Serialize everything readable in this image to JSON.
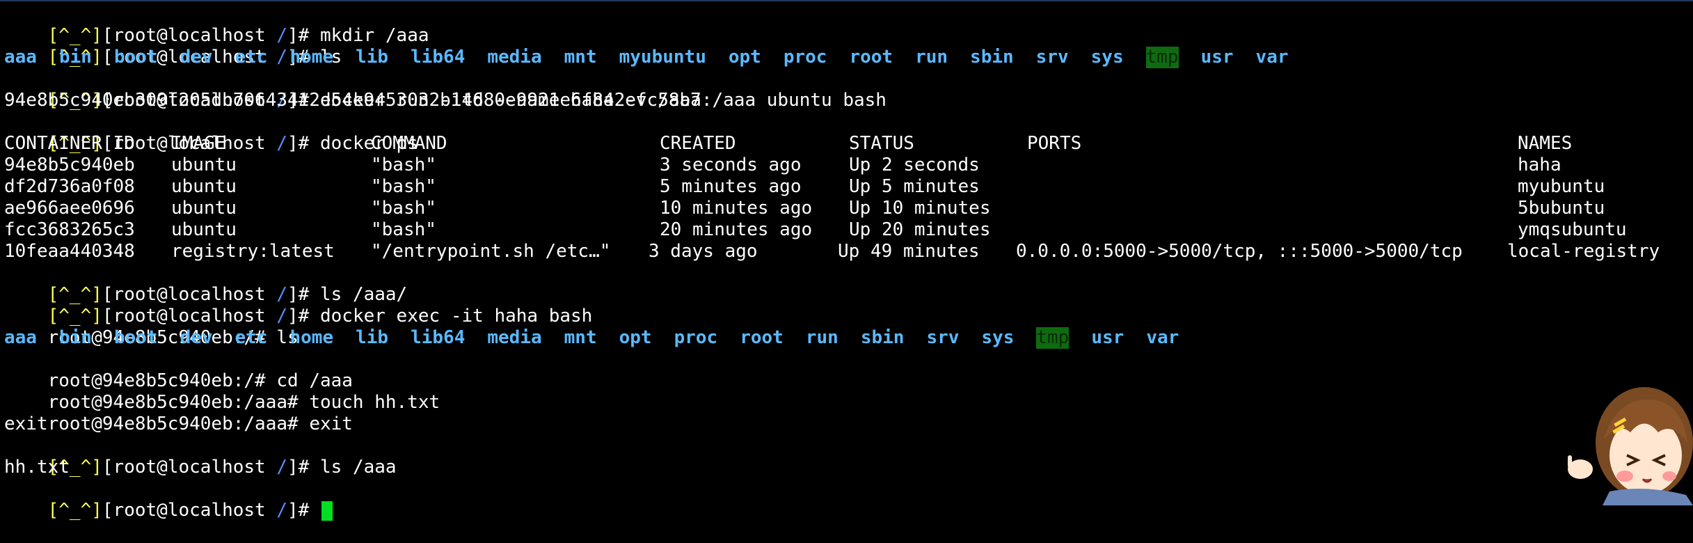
{
  "prompts": {
    "host_face": "[^_^]",
    "host_main": "[root@localhost ",
    "host_slash": "/",
    "host_end": "]# ",
    "container_root": "root@94e8b5c940eb:/# ",
    "container_aaa": "root@94e8b5c940eb:/aaa# "
  },
  "commands": {
    "c1": "mkdir /aaa",
    "c2": "ls",
    "c3": "docker run -itd --name haha -v /aaa:/aaa ubuntu bash",
    "c4": "docker ps",
    "c5": "ls /aaa/",
    "c6": "docker exec -it haha bash",
    "c7": "ls",
    "c8": "cd /aaa",
    "c9": "touch hh.txt",
    "c10": "exit",
    "c11": "ls /aaa"
  },
  "outputs": {
    "container_id_long": "94e8b5c940eb309f205db70643412e54e9453032b14680e9921e6f842efc58b7",
    "exit_text": "exit",
    "hh_file": "hh.txt"
  },
  "host_dirs": [
    "aaa",
    "bin",
    "boot",
    "dev",
    "etc",
    "home",
    "lib",
    "lib64",
    "media",
    "mnt",
    "myubuntu",
    "opt",
    "proc",
    "root",
    "run",
    "sbin",
    "srv",
    "sys",
    "tmp",
    "usr",
    "var"
  ],
  "container_dirs": [
    "aaa",
    "bin",
    "boot",
    "dev",
    "etc",
    "home",
    "lib",
    "lib64",
    "media",
    "mnt",
    "opt",
    "proc",
    "root",
    "run",
    "sbin",
    "srv",
    "sys",
    "tmp",
    "usr",
    "var"
  ],
  "highlighted_dir": "tmp",
  "docker_ps": {
    "headers": [
      "CONTAINER ID",
      "IMAGE",
      "COMMAND",
      "CREATED",
      "STATUS",
      "PORTS",
      "NAMES"
    ],
    "rows": [
      [
        "94e8b5c940eb",
        "ubuntu",
        "\"bash\"",
        "3 seconds ago",
        "Up 2 seconds",
        "",
        "haha"
      ],
      [
        "df2d736a0f08",
        "ubuntu",
        "\"bash\"",
        "5 minutes ago",
        "Up 5 minutes",
        "",
        "myubuntu"
      ],
      [
        "ae966aee0696",
        "ubuntu",
        "\"bash\"",
        "10 minutes ago",
        "Up 10 minutes",
        "",
        "5bubuntu"
      ],
      [
        "fcc3683265c3",
        "ubuntu",
        "\"bash\"",
        "20 minutes ago",
        "Up 20 minutes",
        "",
        "ymqsubuntu"
      ],
      [
        "10feaa440348",
        "registry:latest",
        "\"/entrypoint.sh /etc…\"",
        "3 days ago",
        "Up 49 minutes",
        "0.0.0.0:5000->5000/tcp, :::5000->5000/tcp",
        "local-registry"
      ]
    ]
  },
  "colors": {
    "background": "#000000",
    "prompt_face": "#ffff54",
    "prompt_slash": "#5c8cff",
    "directory": "#5ab9ff",
    "tmp_highlight": "#0f6b0f",
    "cursor": "#00e020"
  }
}
